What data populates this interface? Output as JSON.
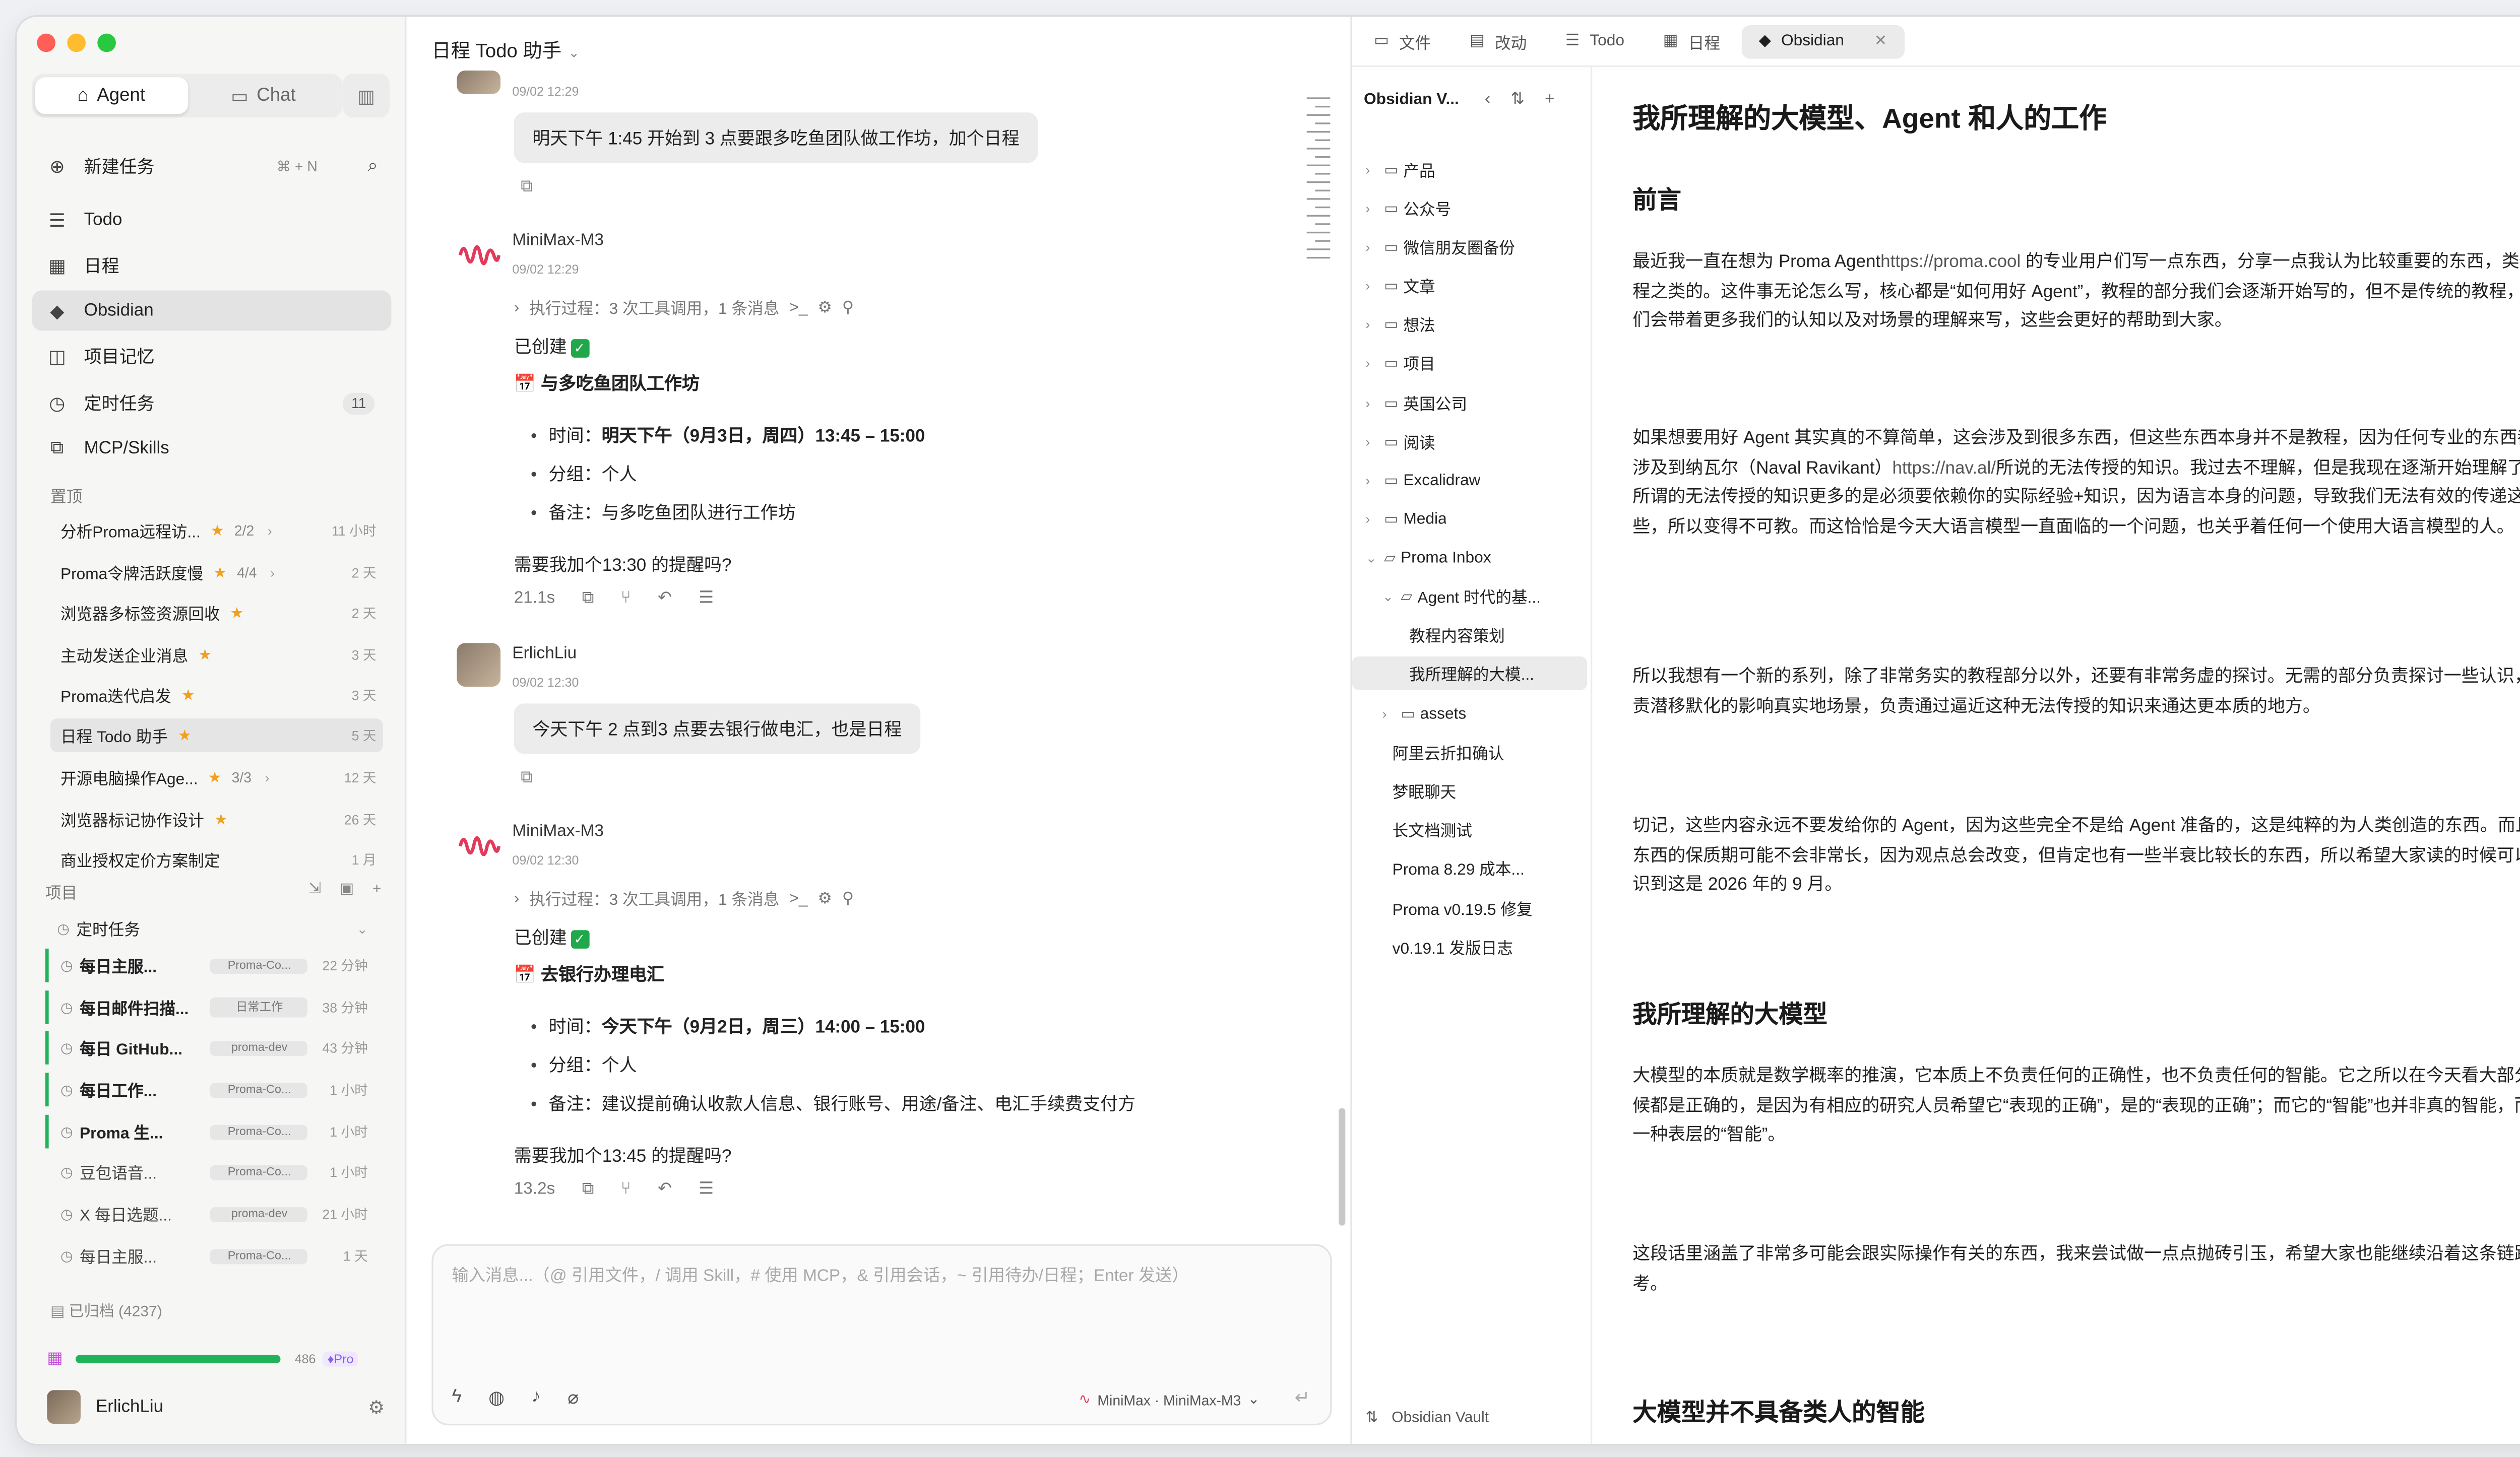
{
  "sidebar": {
    "mode_tabs": [
      {
        "label": "Agent"
      },
      {
        "label": "Chat"
      }
    ],
    "new_task": {
      "label": "新建任务",
      "shortcut": "⌘ + N"
    },
    "nav": [
      {
        "label": "Todo"
      },
      {
        "label": "日程"
      },
      {
        "label": "Obsidian"
      },
      {
        "label": "项目记忆"
      },
      {
        "label": "定时任务",
        "badge": "11"
      },
      {
        "label": "MCP/Skills"
      }
    ],
    "pinned_label": "置顶",
    "pinned": [
      {
        "name": "分析Proma远程访...",
        "progress": "2/2",
        "time": "11 小时"
      },
      {
        "name": "Proma令牌活跃度慢",
        "progress": "4/4",
        "time": "2 天"
      },
      {
        "name": "浏览器多标签资源回收",
        "progress": "",
        "time": "2 天"
      },
      {
        "name": "主动发送企业消息",
        "progress": "",
        "time": "3 天"
      },
      {
        "name": "Proma迭代启发",
        "progress": "",
        "time": "3 天"
      },
      {
        "name": "日程 Todo 助手",
        "progress": "",
        "time": "5 天"
      },
      {
        "name": "开源电脑操作Age...",
        "progress": "3/3",
        "time": "12 天"
      },
      {
        "name": "浏览器标记协作设计",
        "progress": "",
        "time": "26 天"
      },
      {
        "name": "商业授权定价方案制定",
        "progress": "",
        "time": "1 月"
      }
    ],
    "projects_label": "项目",
    "scheduled_group": "定时任务",
    "tasks": [
      {
        "name": "每日主服...",
        "tag": "Proma-Co...",
        "time": "22 分钟"
      },
      {
        "name": "每日邮件扫描...",
        "tag": "日常工作",
        "time": "38 分钟"
      },
      {
        "name": "每日 GitHub...",
        "tag": "proma-dev",
        "time": "43 分钟"
      },
      {
        "name": "每日工作...",
        "tag": "Proma-Co...",
        "time": "1 小时"
      },
      {
        "name": "Proma 生...",
        "tag": "Proma-Co...",
        "time": "1 小时"
      },
      {
        "name": "豆包语音...",
        "tag": "Proma-Co...",
        "time": "1 小时"
      },
      {
        "name": "X 每日选题...",
        "tag": "proma-dev",
        "time": "21 小时"
      },
      {
        "name": "每日主服...",
        "tag": "Proma-Co...",
        "time": "1 天"
      }
    ],
    "archived": "已归档 (4237)",
    "usage": {
      "value": 486,
      "label": "486",
      "fraction": 1.0,
      "plan": "Pro"
    },
    "user": {
      "name": "ErlichLiu"
    }
  },
  "chat": {
    "title": "日程 Todo 助手",
    "top_time": "09/02 12:29",
    "messages": [
      {
        "text": "明天下午 1:45 开始到 3 点要跟多吃鱼团队做工作坊，加个日程"
      },
      {
        "author": "MiniMax-M3",
        "time": "09/02 12:29",
        "exec": "执行过程：3 次工具调用，1 条消息",
        "created": "已创建",
        "event": "📅 与多吃鱼团队工作坊",
        "time_label": "时间：",
        "time_value": "明天下午（9月3日，周四）13:45 – 15:00",
        "group": "分组：个人",
        "note": "备注：与多吃鱼团队进行工作坊",
        "question": "需要我加个13:30 的提醒吗?",
        "duration": "21.1s"
      },
      {
        "author": "ErlichLiu",
        "time": "09/02 12:30",
        "text": "今天下午 2 点到3 点要去银行做电汇，也是日程"
      },
      {
        "author": "MiniMax-M3",
        "time": "09/02 12:30",
        "exec": "执行过程：3 次工具调用，1 条消息",
        "created": "已创建",
        "event": "📅 去银行办理电汇",
        "time_label": "时间：",
        "time_value": "今天下午（9月2日，周三）14:00 – 15:00",
        "group": "分组：个人",
        "note": "备注：建议提前确认收款人信息、银行账号、用途/备注、电汇手续费支付方",
        "question": "需要我加个13:45 的提醒吗?",
        "duration": "13.2s"
      }
    ],
    "composer": {
      "placeholder": "输入消息...（@ 引用文件，/ 调用 Skill，# 使用 MCP，& 引用会话，~ 引用待办/日程；Enter 发送）",
      "model": "MiniMax · MiniMax-M3"
    }
  },
  "tabs": [
    {
      "label": "文件",
      "icon": "folder-icon"
    },
    {
      "label": "改动",
      "icon": "diff-icon"
    },
    {
      "label": "Todo",
      "icon": "todo-icon"
    },
    {
      "label": "日程",
      "icon": "calendar-icon"
    },
    {
      "label": "Obsidian",
      "icon": "obsidian-icon",
      "active": true
    }
  ],
  "tree": {
    "title": "Obsidian V...",
    "folders": [
      {
        "label": "产品"
      },
      {
        "label": "公众号"
      },
      {
        "label": "微信朋友圈备份"
      },
      {
        "label": "文章"
      },
      {
        "label": "想法"
      },
      {
        "label": "项目"
      },
      {
        "label": "英国公司"
      },
      {
        "label": "阅读"
      },
      {
        "label": "Excalidraw"
      },
      {
        "label": "Media"
      }
    ],
    "inbox": "Proma Inbox",
    "agent_folder": "Agent 时代的基...",
    "agent_files": [
      "教程内容策划",
      "我所理解的大模..."
    ],
    "assets": "assets",
    "inbox_files": [
      "阿里云折扣确认",
      "梦眠聊天",
      "长文档测试",
      "Proma 8.29 成本...",
      "Proma v0.19.5 修复",
      "v0.19.1 发版日志"
    ],
    "vault": "Obsidian Vault"
  },
  "doc": {
    "title": "我所理解的大模型、Agent 和人的工作",
    "h_preface": "前言",
    "p1a": "最近我一直在想为 Proma Agent",
    "p1link": "https://proma.cool",
    "p1b": " 的专业用户们写一点东西，分享一点我认为比较重要的东西，类似教程之类的。这件事无论怎么写，核心都是“如何用好 Agent”，教程的部分我们会逐渐开始写的，但不是传统的教程，我们会带着更多我们的认知以及对场景的理解来写，这些会更好的帮助到大家。",
    "p2a": "如果想要用好 Agent 其实真的不算简单，这会涉及到很多东西，但这些东西本身并不是教程，因为任何专业的东西都会涉及到纳瓦尔（Naval Ravikant）",
    "p2link": "https://nav.al/",
    "p2b": "所说的无法传授的知识。我过去不理解，但是我现在逐渐开始理解了，所谓的无法传授的知识更多的是必须要依赖你的实际经验+知识，因为语言本身的问题，导致我们无法有效的传递这些，所以变得不可教。而这恰恰是今天大语言模型一直面临的一个问题，也关乎着任何一个使用大语言模型的人。",
    "p3": "所以我想有一个新的系列，除了非常务实的教程部分以外，还要有非常务虚的探讨。无需的部分负责探讨一些认识，负责潜移默化的影响真实地场景，负责通过逼近这种无法传授的知识来通达更本质的地方。",
    "p4": "切记，这些内容永远不要发给你的 Agent，因为这些完全不是给 Agent 准备的，这是纯粹的为人类创造的东西。而且这东西的保质期可能不会非常长，因为观点总会改变，但肯定也有一些半衰比较长的东西，所以希望大家读的时候可以意识到这是 2026 年的 9 月。",
    "h_llm": "我所理解的大模型",
    "p5": "大模型的本质就是数学概率的推演，它本质上不负责任何的正确性，也不负责任何的智能。它之所以在今天看大部分时候都是正确的，是因为有相应的研究人员希望它“表现的正确”，是的“表现的正确”；而它的“智能”也并非真的智能，而是一种表层的“智能”。",
    "p6": "这段话里涵盖了非常多可能会跟实际操作有关的东西，我来尝试做一点点抛砖引玉，希望大家也能继续沿着这条链路思考。",
    "h_no_human": "大模型并不具备类人的智能"
  }
}
